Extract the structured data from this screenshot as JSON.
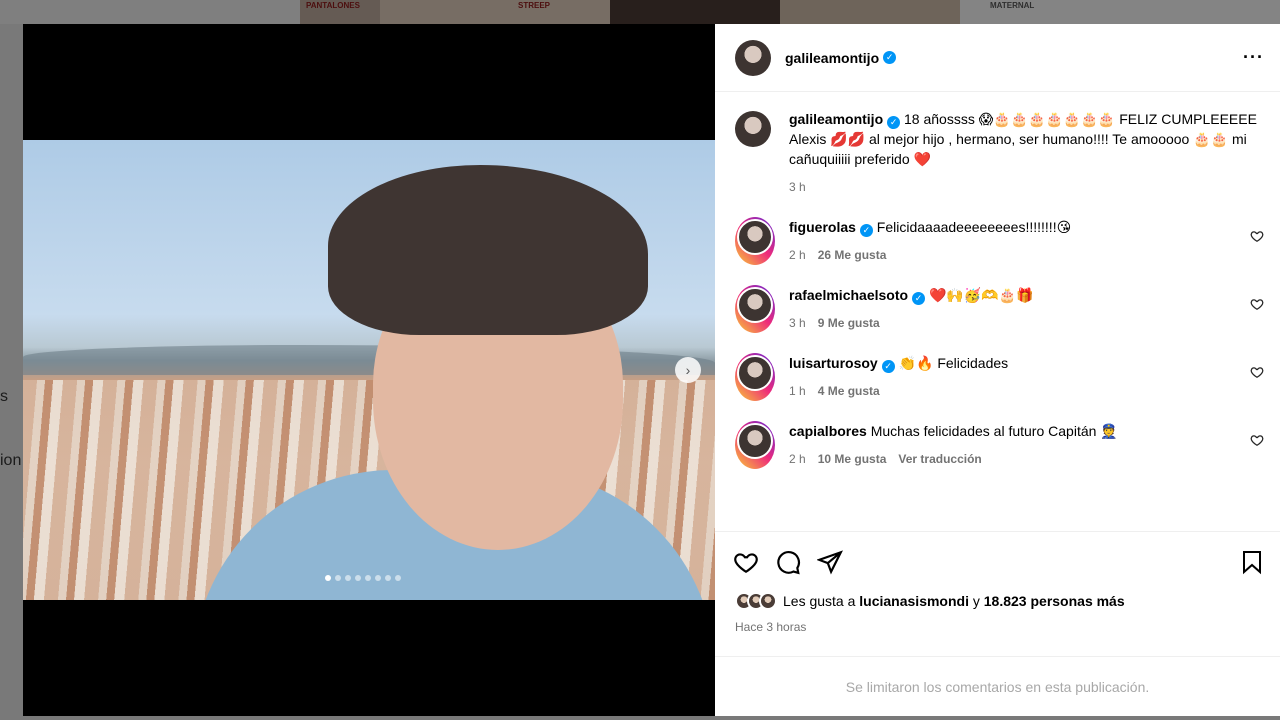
{
  "background": {
    "tile1_text": "PANTALONES",
    "tile2_text": "STREEP",
    "tile3_text": "MATERNAL",
    "side_left": [
      "s",
      "ion"
    ]
  },
  "post": {
    "author": "galileamontijo",
    "more_icon": "more-horizontal-icon",
    "caption": "18 añossss 😱🎂🎂🎂🎂🎂🎂🎂 FELIZ CUMPLEEEEE Alexis 💋💋 al mejor hijo , hermano, ser humano!!!! Te amooooo 🎂🎂 mi cañuquiiiii preferido ❤️",
    "caption_time": "3 h",
    "carousel_dots": 8,
    "carousel_active": 0
  },
  "comments": [
    {
      "user": "figuerolas",
      "verified": true,
      "text": "Felicidaaaadeeeeeeees!!!!!!!!😘",
      "time": "2 h",
      "likes": "26 Me gusta",
      "extra": ""
    },
    {
      "user": "rafaelmichaelsoto",
      "verified": true,
      "text": "❤️🙌🥳🫶🎂🎁",
      "time": "3 h",
      "likes": "9 Me gusta",
      "extra": ""
    },
    {
      "user": "luisarturosoy",
      "verified": true,
      "text": "👏🔥 Felicidades",
      "time": "1 h",
      "likes": "4 Me gusta",
      "extra": ""
    },
    {
      "user": "capialbores",
      "verified": false,
      "text": "Muchas felicidades al futuro Capitán 👮",
      "time": "2 h",
      "likes": "10 Me gusta",
      "extra": "Ver traducción"
    }
  ],
  "likes_line": {
    "prefix": "Les gusta a",
    "user": "lucianasismondi",
    "middle": "y",
    "count": "18.823 personas más"
  },
  "post_time": "Hace 3 horas",
  "comments_limited": "Se limitaron los comentarios en esta publicación.",
  "colors": {
    "verified": "#0095f6",
    "text": "#000000",
    "muted": "#737373"
  }
}
